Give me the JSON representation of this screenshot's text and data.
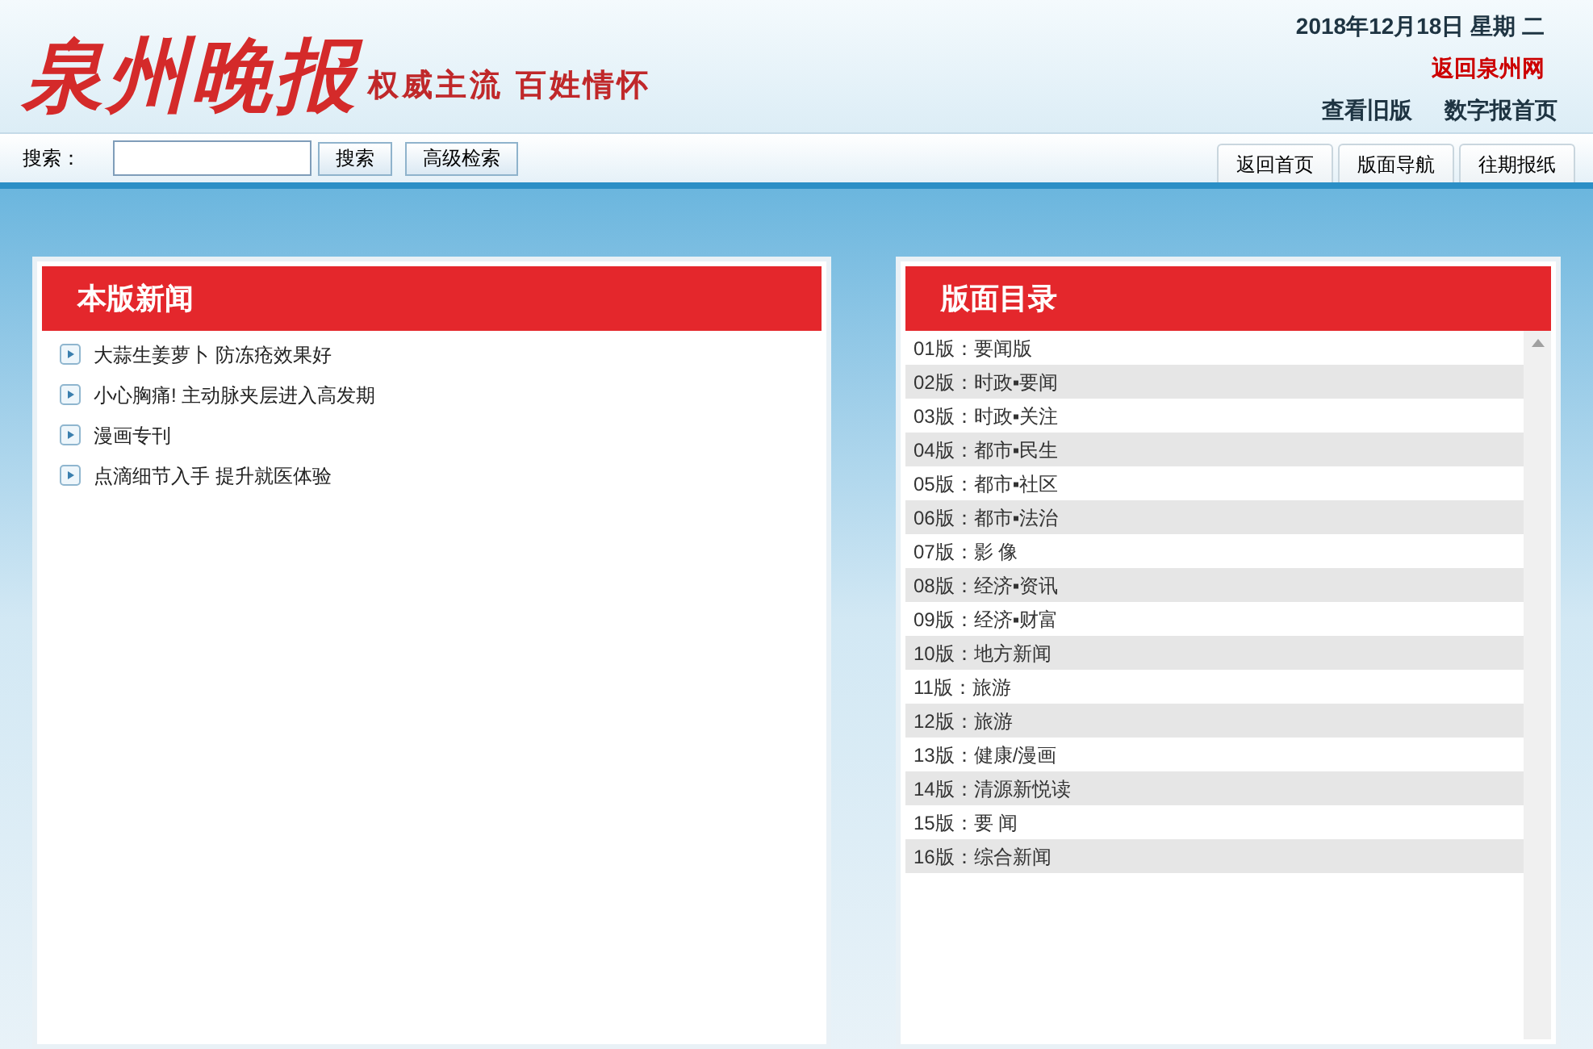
{
  "header": {
    "logo": "泉州晚报",
    "slogan": "权威主流 百姓情怀",
    "date": "2018年12月18日 星期 二",
    "links": [
      {
        "label": "返回泉州网",
        "kind": "highlight"
      },
      {
        "label": "查看旧版",
        "kind": "plain"
      },
      {
        "label": "数字报首页",
        "kind": "plain"
      }
    ]
  },
  "search": {
    "label": "搜索：",
    "buttons": [
      "搜索",
      "高级检索"
    ]
  },
  "nav_tabs": [
    "返回首页",
    "版面导航",
    "往期报纸"
  ],
  "news_panel": {
    "title": "本版新闻",
    "items": [
      "大蒜生姜萝卜 防冻疮效果好",
      "小心胸痛! 主动脉夹层进入高发期",
      "漫画专刊",
      "点滴细节入手 提升就医体验"
    ]
  },
  "pages_panel": {
    "title": "版面目录",
    "items": [
      "01版：要闻版",
      "02版：时政▪要闻",
      "03版：时政▪关注",
      "04版：都市▪民生",
      "05版：都市▪社区",
      "06版：都市▪法治",
      "07版：影 像",
      "08版：经济▪资讯",
      "09版：经济▪财富",
      "10版：地方新闻",
      "11版：旅游",
      "12版：旅游",
      "13版：健康/漫画",
      "14版：清源新悦读",
      "15版：要 闻",
      "16版：综合新闻"
    ]
  }
}
